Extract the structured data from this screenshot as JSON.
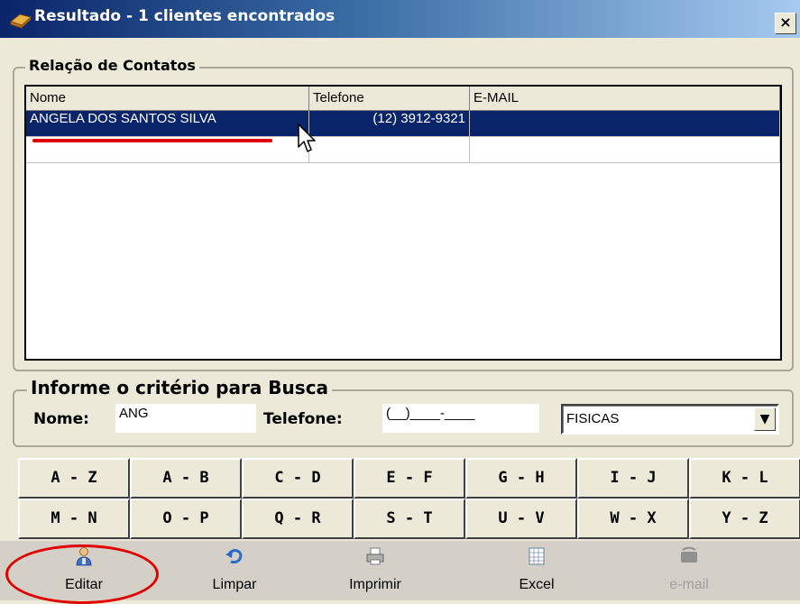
{
  "window": {
    "title": "Resultado - 1 clientes encontrados",
    "close_label": "×"
  },
  "contacts_group": {
    "legend": "Relação de Contatos",
    "columns": [
      "Nome",
      "Telefone",
      "E-MAIL"
    ],
    "rows": [
      {
        "nome": "ANGELA DOS SANTOS SILVA",
        "telefone": "(12) 3912-9321",
        "email": ""
      }
    ]
  },
  "search_group": {
    "legend": "Informe o critério para Busca",
    "nome_label": "Nome:",
    "nome_value": "ANG",
    "telefone_label": "Telefone:",
    "telefone_value": "(__)____-____",
    "tipo_value": "FISICAS"
  },
  "letter_buttons": {
    "row1": [
      "A - Z",
      "A - B",
      "C - D",
      "E - F",
      "G - H",
      "I - J",
      "K - L"
    ],
    "row2": [
      "M - N",
      "O - P",
      "Q - R",
      "S - T",
      "U - V",
      "W - X",
      "Y - Z"
    ]
  },
  "toolbar": {
    "editar": "Editar",
    "limpar": "Limpar",
    "imprimir": "Imprimir",
    "excel": "Excel",
    "email": "e-mail"
  },
  "colors": {
    "selection": "#0a246a",
    "annotation": "#e00000",
    "window_bg": "#ece9d8"
  },
  "icons": [
    "book-icon",
    "user-edit-icon",
    "undo-icon",
    "printer-icon",
    "spreadsheet-icon",
    "mail-icon",
    "chevron-down-icon",
    "mouse-cursor-icon"
  ]
}
